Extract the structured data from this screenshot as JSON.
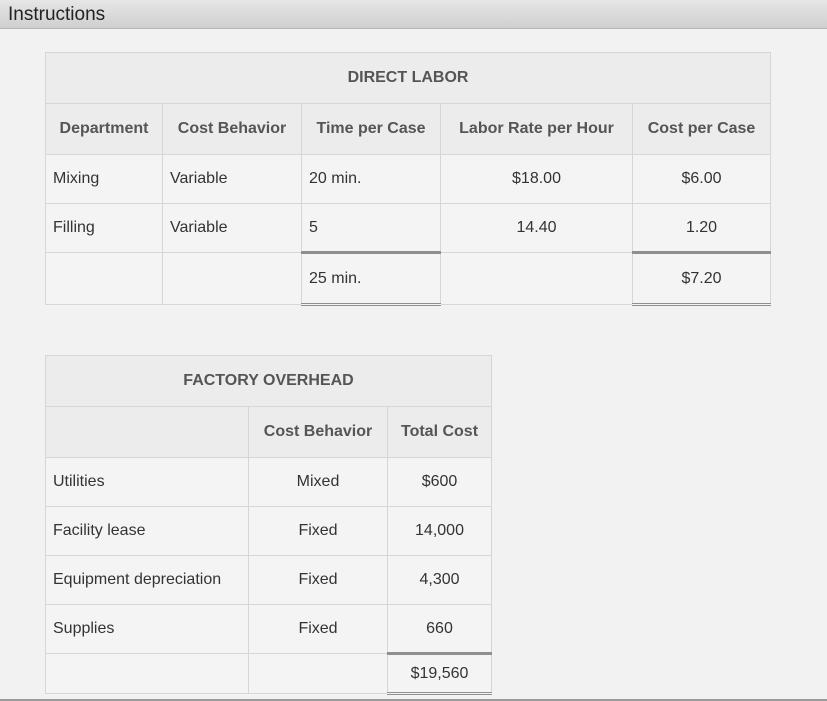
{
  "window": {
    "title": "Instructions"
  },
  "direct_labor": {
    "caption": "DIRECT LABOR",
    "headers": [
      "Department",
      "Cost Behavior",
      "Time per Case",
      "Labor Rate per Hour",
      "Cost per Case"
    ],
    "rows": [
      {
        "department": "Mixing",
        "behavior": "Variable",
        "time": "20 min.",
        "rate": "$18.00",
        "cost": "$6.00"
      },
      {
        "department": "Filling",
        "behavior": "Variable",
        "time": "5",
        "rate": "14.40",
        "cost": "1.20"
      }
    ],
    "totals": {
      "time": "25 min.",
      "cost": "$7.20"
    }
  },
  "factory_overhead": {
    "caption": "FACTORY OVERHEAD",
    "headers": [
      "",
      "Cost Behavior",
      "Total Cost"
    ],
    "rows": [
      {
        "item": "Utilities",
        "behavior": "Mixed",
        "cost": "$600"
      },
      {
        "item": "Facility lease",
        "behavior": "Fixed",
        "cost": "14,000"
      },
      {
        "item": "Equipment depreciation",
        "behavior": "Fixed",
        "cost": "4,300"
      },
      {
        "item": "Supplies",
        "behavior": "Fixed",
        "cost": "660"
      }
    ],
    "total": "$19,560"
  }
}
